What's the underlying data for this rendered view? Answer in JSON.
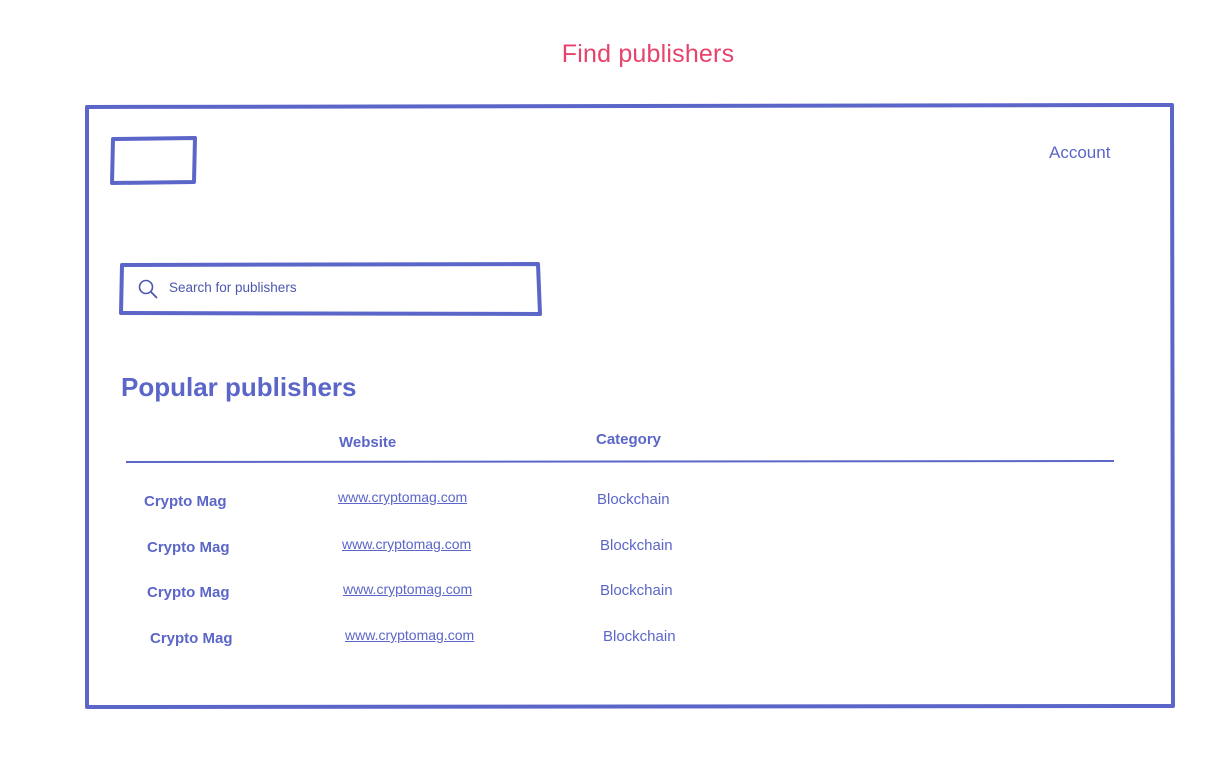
{
  "page": {
    "title": "Find publishers"
  },
  "header": {
    "logo_label": "",
    "account_label": "Account"
  },
  "search": {
    "placeholder": "Search for publishers",
    "icon": "search-icon"
  },
  "popular": {
    "title": "Popular publishers",
    "columns": [
      "",
      "Website",
      "Category"
    ],
    "rows": [
      {
        "name": "Crypto Mag",
        "website": "www.cryptomag.com",
        "category": "Blockchain"
      },
      {
        "name": "Crypto Mag",
        "website": "www.cryptomag.com",
        "category": "Blockchain"
      },
      {
        "name": "Crypto Mag",
        "website": "www.cryptomag.com",
        "category": "Blockchain"
      },
      {
        "name": "Crypto Mag",
        "website": "www.cryptomag.com",
        "category": "Blockchain"
      }
    ]
  },
  "colors": {
    "stroke": "#5b66c8",
    "title_accent": "#e8426b"
  }
}
